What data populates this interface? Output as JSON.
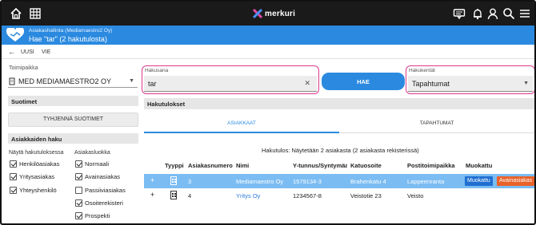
{
  "app": {
    "brand": "merkuri"
  },
  "header": {
    "breadcrumb": "Asiakashallinta (Mediamaestro2 Oy)",
    "title": "Hae \"tar\" (2 hakutulosta)"
  },
  "toolbar": {
    "new_label": "UUSI",
    "export_label": "VIE"
  },
  "left": {
    "org_label": "Toimipaikka",
    "org_value": "MED MEDIAMAESTRO2 OY",
    "filters_title": "Suotimet",
    "clear_filters": "TYHJENNÄ SUOTIMET",
    "customer_search_title": "Asiakkaiden haku",
    "show_in_results_label": "Näytä hakutuloksessa",
    "show_options": [
      {
        "label": "Henkilöasiakas",
        "checked": true
      },
      {
        "label": "Yritysasiakas",
        "checked": true
      },
      {
        "label": "Yhteyshenkilö",
        "checked": true
      }
    ],
    "customer_class_label": "Asiakasluokka",
    "class_options": [
      {
        "label": "Normaali",
        "checked": true
      },
      {
        "label": "Avainasiakas",
        "checked": true
      },
      {
        "label": "Passiiviasiakas",
        "checked": false
      },
      {
        "label": "Osoiterekisteri",
        "checked": true
      },
      {
        "label": "Prospekti",
        "checked": true
      }
    ]
  },
  "search": {
    "term_label": "Hakusana",
    "term_value": "tar",
    "button": "HAE",
    "fields_label": "Hakukentät",
    "fields_value": "Tapahtumat"
  },
  "results": {
    "title": "Hakutulokset",
    "tabs": [
      "ASIAKKAAT",
      "TAPAHTUMAT"
    ],
    "summary": "Hakutulos: Näytetään 2 asiakasta (2 asiakasta rekisterissä)",
    "columns": [
      "Tyyppi",
      "Asiakasnumero",
      "Nimi",
      "Y-tunnus/Syntymäaika",
      "Katuosoite",
      "Postitoimipaikka",
      "Muokattu"
    ],
    "rows": [
      {
        "expand": "+",
        "number": "3",
        "name": "Mediamaestro Oy",
        "ytunnus": "1579134-3",
        "street": "Brahenkatu 4",
        "city": "Lappeenranta",
        "edit": "Muokattu",
        "key": "Avainasiakas"
      },
      {
        "expand": "+",
        "number": "4",
        "name": "Yritys Oy",
        "ytunnus": "1234567-8",
        "street": "Veistotie 23",
        "city": "Veisto"
      }
    ]
  },
  "colors": {
    "accent": "#2b8ae0",
    "highlight_border": "#d93b8f",
    "selected_row": "#7bbcf2",
    "key_badge": "#e8622a"
  }
}
